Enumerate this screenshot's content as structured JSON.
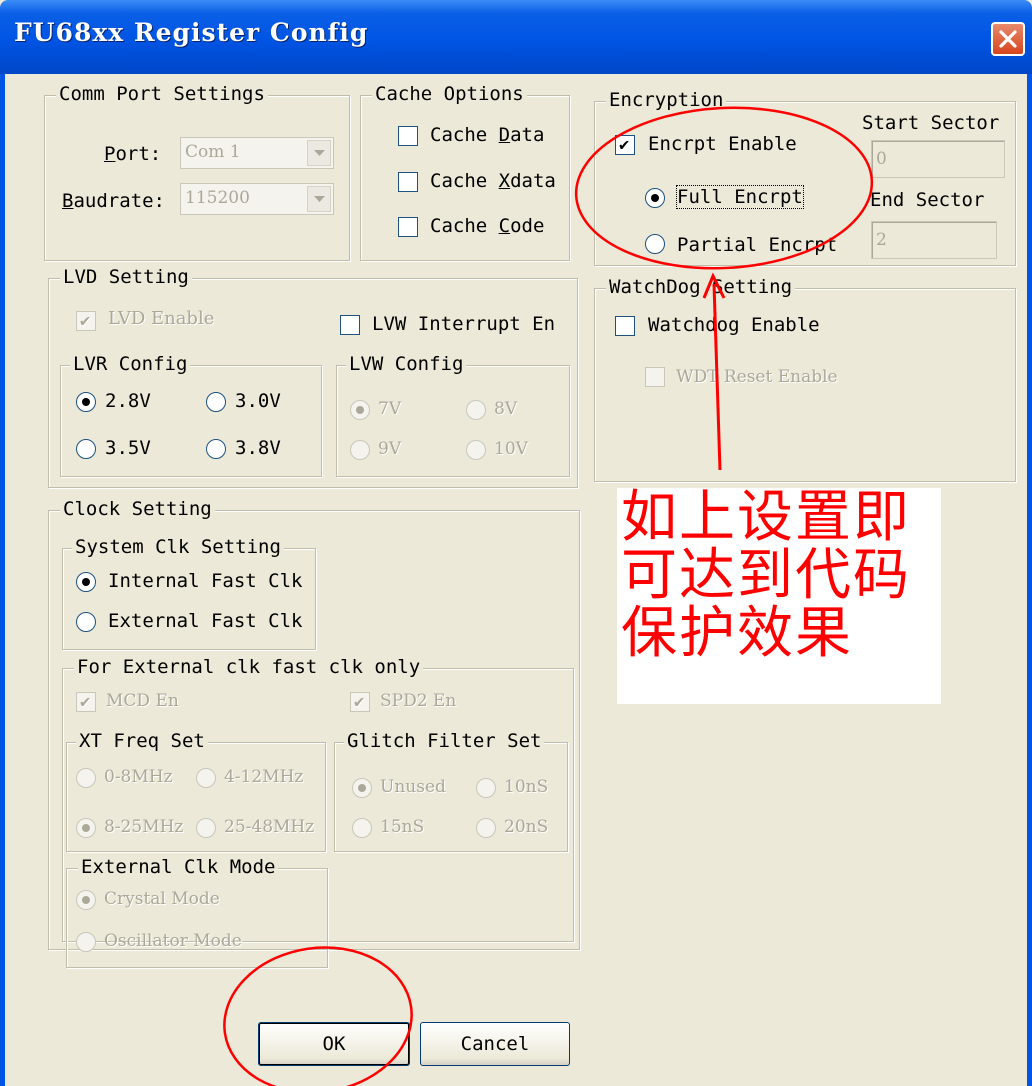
{
  "window": {
    "title": "FU68xx Register Config"
  },
  "comm": {
    "title": "Comm Port Settings",
    "port_label": "Port:",
    "port_value": "Com 1",
    "baud_label": "Baudrate:",
    "baud_value": "115200"
  },
  "cache": {
    "title": "Cache Options",
    "data": "Cache Data",
    "xdata": "Cache Xdata",
    "code": "Cache Code"
  },
  "encryption": {
    "title": "Encryption",
    "enable": "Encrpt Enable",
    "full": "Full Encrpt",
    "partial": "Partial Encrpt",
    "start_label": "Start Sector",
    "start_value": "0",
    "end_label": "End Sector",
    "end_value": "2"
  },
  "lvd": {
    "title": "LVD Setting",
    "enable": "LVD Enable",
    "lvw_int": "LVW Interrupt En",
    "lvr_title": "LVR Config",
    "lvr_options": [
      "2.8V",
      "3.0V",
      "3.5V",
      "3.8V"
    ],
    "lvw_title": "LVW Config",
    "lvw_options": [
      "7V",
      "8V",
      "9V",
      "10V"
    ]
  },
  "watchdog": {
    "title": "WatchDog Setting",
    "enable": "Watchdog Enable",
    "wdt_reset": "WDT Reset Enable"
  },
  "clock": {
    "title": "Clock Setting",
    "sys_title": "System Clk Setting",
    "internal": "Internal Fast Clk",
    "external": "External Fast Clk",
    "ext_only_title": "For External clk fast clk only",
    "mcd": "MCD En",
    "spd2": "SPD2 En",
    "xt_title": "XT Freq Set",
    "xt_options": [
      "0-8MHz",
      "4-12MHz",
      "8-25MHz",
      "25-48MHz"
    ],
    "glitch_title": "Glitch Filter Set",
    "glitch_options": [
      "Unused",
      "10nS",
      "15nS",
      "20nS"
    ],
    "mode_title": "External Clk Mode",
    "crystal": "Crystal Mode",
    "oscillator": "Oscillator Mode"
  },
  "buttons": {
    "ok": "OK",
    "cancel": "Cancel"
  },
  "annotation": {
    "lines": [
      "如上设置即",
      "可达到代码",
      "保护效果"
    ],
    "color": "#ff0000"
  }
}
